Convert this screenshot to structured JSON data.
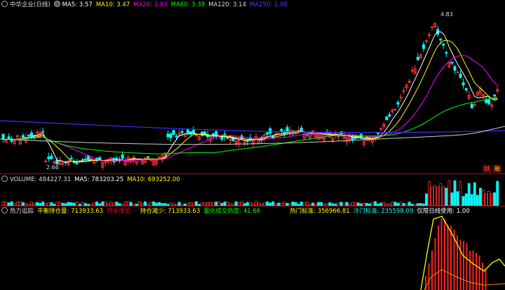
{
  "price": {
    "title": "中华企业(日线)",
    "ma": [
      {
        "label": "MA5: 3.57",
        "color": "#ffffff"
      },
      {
        "label": "MA10: 3.47",
        "color": "#ffff00"
      },
      {
        "label": "MA20: 3.83",
        "color": "#ff00ff"
      },
      {
        "label": "MA60: 3.38",
        "color": "#00ff00"
      },
      {
        "label": "MA120: 3.14",
        "color": "#dddddd"
      },
      {
        "label": "MA250: 1.98",
        "color": "#4444ff"
      }
    ],
    "high_label": "4.83",
    "low_label": "2.66",
    "badge_left": "财",
    "badge_right": "融"
  },
  "volume": {
    "label": "VOLUME: 484227.31",
    "ma5": "MA5: 783203.25",
    "ma10": "MA10: 693252.00"
  },
  "indicator": {
    "name": "热力追踪",
    "items": [
      {
        "label": "平衡持仓量: 713933.63",
        "color": "#ffff00"
      },
      {
        "label": "持仓增加: -",
        "color": "#ff0000"
      },
      {
        "label": "持仓减少: 713933.63",
        "color": "#ffff00"
      },
      {
        "label": "量化成交热度: 41.66",
        "color": "#00ff00"
      }
    ],
    "items2": [
      {
        "label": "热门标准: 356966.81",
        "color": "#ffff00"
      },
      {
        "label": "冷门标准: 235598.09",
        "color": "#00ffff"
      },
      {
        "label": "仅限日线使用: 1.00",
        "color": "#ffffff"
      }
    ]
  }
}
